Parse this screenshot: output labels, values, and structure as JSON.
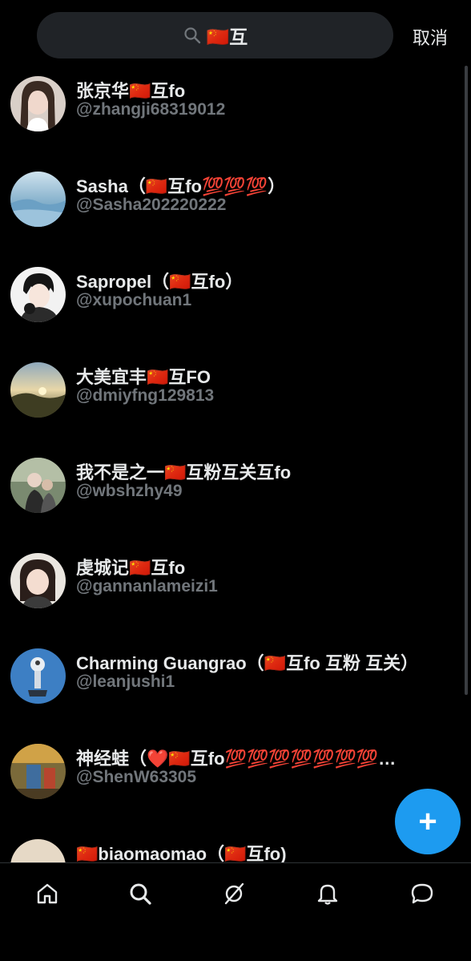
{
  "search": {
    "query": "🇨🇳互",
    "cancel_label": "取消"
  },
  "results": [
    {
      "name": "张京华🇨🇳互fo",
      "handle": "@zhangji68319012",
      "avatar": "portrait-woman"
    },
    {
      "name": "Sasha（🇨🇳互fo💯💯💯）",
      "handle": "@Sasha202220222",
      "avatar": "blue-landscape"
    },
    {
      "name": "Sapropel（🇨🇳互fo）",
      "handle": "@xupochuan1",
      "avatar": "anime-boy"
    },
    {
      "name": "大美宜丰🇨🇳互FO",
      "handle": "@dmiyfng129813",
      "avatar": "sunset-hills"
    },
    {
      "name": "我不是之一🇨🇳互粉互关互fo",
      "handle": "@wbshzhy49",
      "avatar": "photo-couple"
    },
    {
      "name": "虔城记🇨🇳互fo",
      "handle": "@gannanlameizi1",
      "avatar": "portrait-girl"
    },
    {
      "name": "Charming Guangrao（🇨🇳互fo 互粉 互关）",
      "handle": "@leanjushi1",
      "avatar": "blue-statue"
    },
    {
      "name": "神经蛙（❤️🇨🇳互fo💯💯💯💯💯💯💯…",
      "handle": "@ShenW63305",
      "avatar": "street-scene"
    },
    {
      "name": "🇨🇳biaomaomao（🇨🇳互fo)",
      "handle": "",
      "avatar": "beach-scene"
    }
  ],
  "colors": {
    "accent": "#1d9bf0",
    "muted": "#71767b",
    "text": "#e7e9ea",
    "bg": "#000000"
  },
  "fab": {
    "label": "+"
  },
  "nav": [
    "home-icon",
    "search-icon",
    "grok-icon",
    "notifications-icon",
    "messages-icon"
  ]
}
